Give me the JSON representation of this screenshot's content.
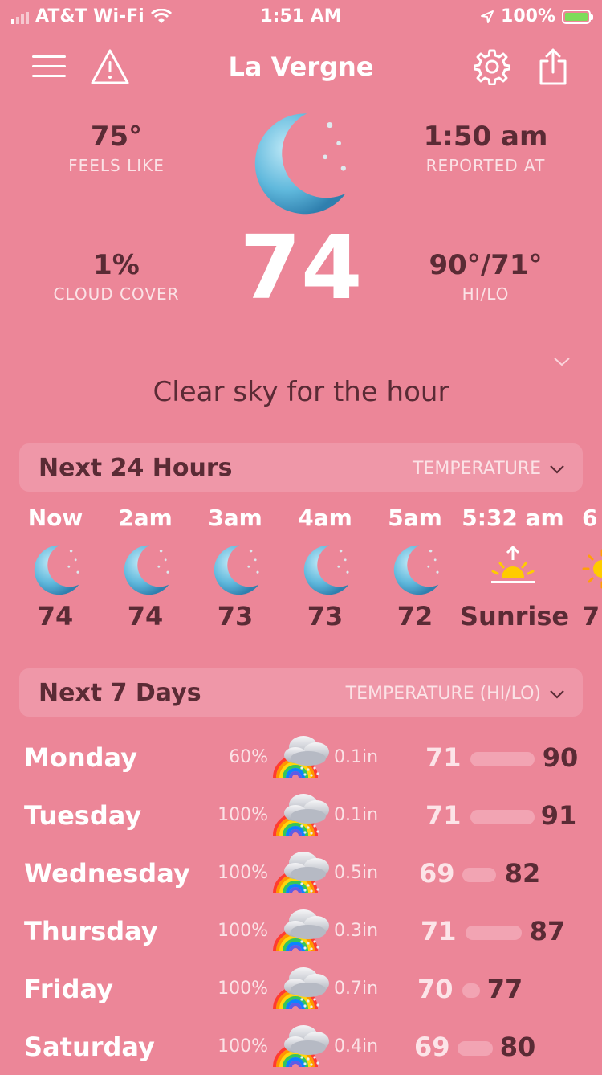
{
  "status_bar": {
    "carrier": "AT&T Wi-Fi",
    "time": "1:51 AM",
    "battery": "100%"
  },
  "header": {
    "title": "La Vergne"
  },
  "current": {
    "feels_like": {
      "value": "75°",
      "label": "FEELS LIKE"
    },
    "reported_at": {
      "value": "1:50 am",
      "label": "REPORTED AT"
    },
    "cloud_cover": {
      "value": "1%",
      "label": "CLOUD COVER"
    },
    "hi_lo": {
      "value": "90°/71°",
      "label": "HI/LO"
    },
    "temperature": "74",
    "summary": "Clear sky for the hour",
    "icon": "moon-icon"
  },
  "hourly": {
    "title": "Next 24 Hours",
    "selector": "TEMPERATURE",
    "items": [
      {
        "time": "Now",
        "value": "74",
        "icon": "moon-icon"
      },
      {
        "time": "2am",
        "value": "74",
        "icon": "moon-icon"
      },
      {
        "time": "3am",
        "value": "73",
        "icon": "moon-icon"
      },
      {
        "time": "4am",
        "value": "73",
        "icon": "moon-icon"
      },
      {
        "time": "5am",
        "value": "72",
        "icon": "moon-icon"
      },
      {
        "time": "5:32 am",
        "value": "Sunrise",
        "icon": "sunrise-icon"
      },
      {
        "time": "6",
        "value": "7",
        "icon": "sun-icon"
      }
    ]
  },
  "daily": {
    "title": "Next 7 Days",
    "selector": "TEMPERATURE (HI/LO)",
    "items": [
      {
        "day": "Monday",
        "precip_chance": "60%",
        "precip": "0.1in",
        "lo": "71",
        "hi": "90",
        "icon": "rain-cloud-rainbow-icon"
      },
      {
        "day": "Tuesday",
        "precip_chance": "100%",
        "precip": "0.1in",
        "lo": "71",
        "hi": "91",
        "icon": "rain-cloud-rainbow-icon"
      },
      {
        "day": "Wednesday",
        "precip_chance": "100%",
        "precip": "0.5in",
        "lo": "69",
        "hi": "82",
        "icon": "rain-cloud-rainbow-icon"
      },
      {
        "day": "Thursday",
        "precip_chance": "100%",
        "precip": "0.3in",
        "lo": "71",
        "hi": "87",
        "icon": "rain-cloud-rainbow-icon"
      },
      {
        "day": "Friday",
        "precip_chance": "100%",
        "precip": "0.7in",
        "lo": "70",
        "hi": "77",
        "icon": "rain-cloud-rainbow-icon"
      },
      {
        "day": "Saturday",
        "precip_chance": "100%",
        "precip": "0.4in",
        "lo": "69",
        "hi": "80",
        "icon": "rain-cloud-rainbow-icon"
      }
    ]
  },
  "colors": {
    "background": "#ec8698",
    "dark_text": "#5a2b35",
    "section_bg": "#ef97a8"
  }
}
